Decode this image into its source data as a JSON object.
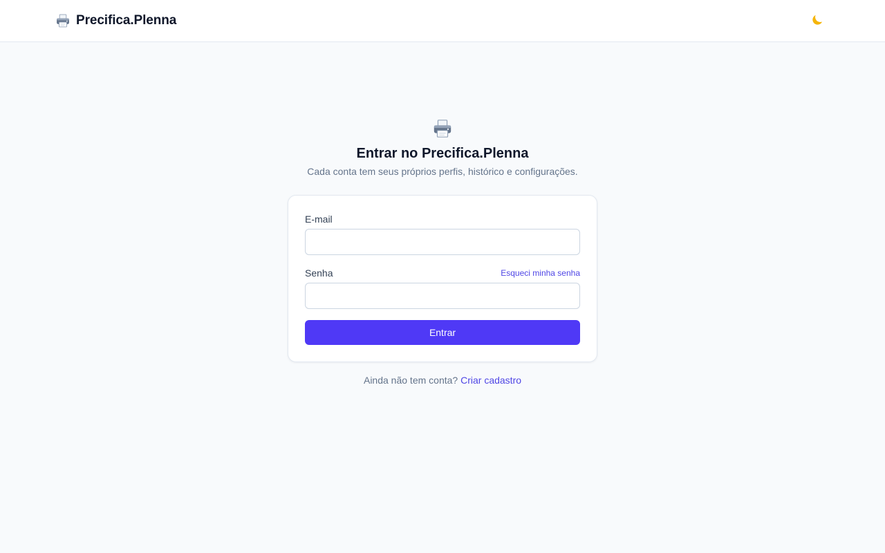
{
  "header": {
    "brand_icon": "printer-icon",
    "brand_name": "Precifica.Plenna",
    "theme_toggle_icon": "moon-icon"
  },
  "hero": {
    "icon": "printer-icon",
    "title": "Entrar no Precifica.Plenna",
    "subtitle": "Cada conta tem seus próprios perfis, histórico e configurações."
  },
  "login_form": {
    "email_label": "E-mail",
    "email_value": "",
    "email_placeholder": "",
    "password_label": "Senha",
    "password_value": "",
    "password_placeholder": "",
    "forgot_password": "Esqueci minha senha",
    "submit_label": "Entrar"
  },
  "signup": {
    "prompt": "Ainda não tem conta?",
    "link": "Criar cadastro"
  },
  "colors": {
    "accent": "#4f39f6",
    "link": "#4f46e5",
    "background": "#f8fafc",
    "moon": "#f5b50a"
  }
}
